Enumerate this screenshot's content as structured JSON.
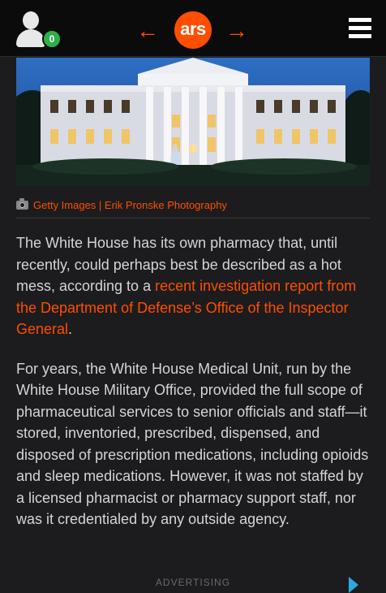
{
  "header": {
    "notification_count": "0",
    "logo_text": "ars",
    "prev_arrow": "←",
    "next_arrow": "→"
  },
  "hero": {
    "caption_credit": "Getty Images | Erik Pronske Photography"
  },
  "article": {
    "p1_before_link": "The White House has its own pharmacy that, until recently, could perhaps best be described as a hot mess, according to a ",
    "p1_link": "recent investigation report from the Department of Defense’s Office of the Inspector General",
    "p1_after_link": ".",
    "p2": "For years, the White House Medical Unit, run by the White House Military Office, provided the full scope of pharmaceutical services to senior officials and staff—it stored, inventoried, prescribed, dispensed, and disposed of prescription medications, including opioids and sleep medications. However, it was not staffed by a licensed pharmacist or pharmacy support staff, nor was it credentialed by any outside agency."
  },
  "ad": {
    "label": "ADVERTISING"
  },
  "colors": {
    "accent": "#ff4e00",
    "badge": "#2db14a",
    "background": "#1c1c1e",
    "topbar": "#0b0b0b"
  }
}
